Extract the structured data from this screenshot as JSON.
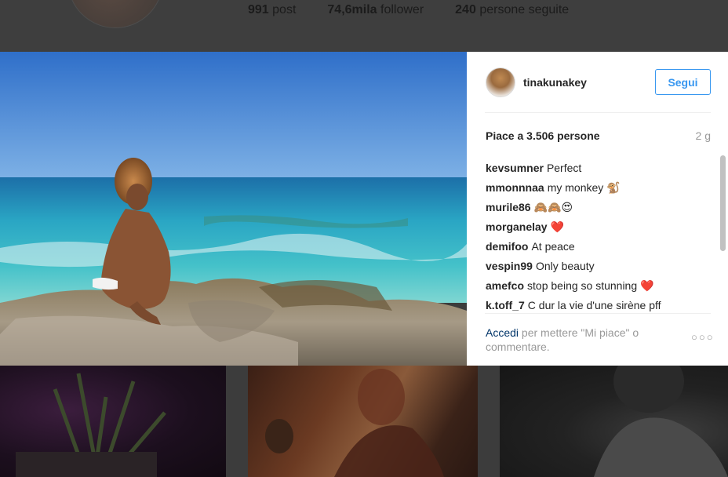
{
  "profile": {
    "stats": [
      {
        "count": "991",
        "label": "post"
      },
      {
        "count": "74,6mila",
        "label": "follower"
      },
      {
        "count": "240",
        "label": "persone seguite"
      }
    ]
  },
  "post": {
    "author": "tinakunakey",
    "follow_label": "Segui",
    "likes_text": "Piace a 3.506 persone",
    "time_ago": "2 g",
    "comments": [
      {
        "user": "kevsumner",
        "text": "Perfect"
      },
      {
        "user": "mmonnnaa",
        "text": "my monkey 🐒"
      },
      {
        "user": "murile86",
        "text": "🙈🙈😍"
      },
      {
        "user": "morganelay",
        "text": "❤️"
      },
      {
        "user": "demifoo",
        "text": "At peace"
      },
      {
        "user": "vespin99",
        "text": "Only beauty"
      },
      {
        "user": "amefco",
        "text": "stop being so stunning ❤️"
      },
      {
        "user": "k.toff_7",
        "text": "C dur la vie d'une sirène pff"
      }
    ],
    "login_link": "Accedi",
    "login_text": " per mettere \"Mi piace\" o commentare.",
    "more_icon": "ellipsis-icon"
  },
  "colors": {
    "accent": "#3897f0",
    "link": "#003569",
    "muted": "#999999",
    "text": "#262626"
  }
}
